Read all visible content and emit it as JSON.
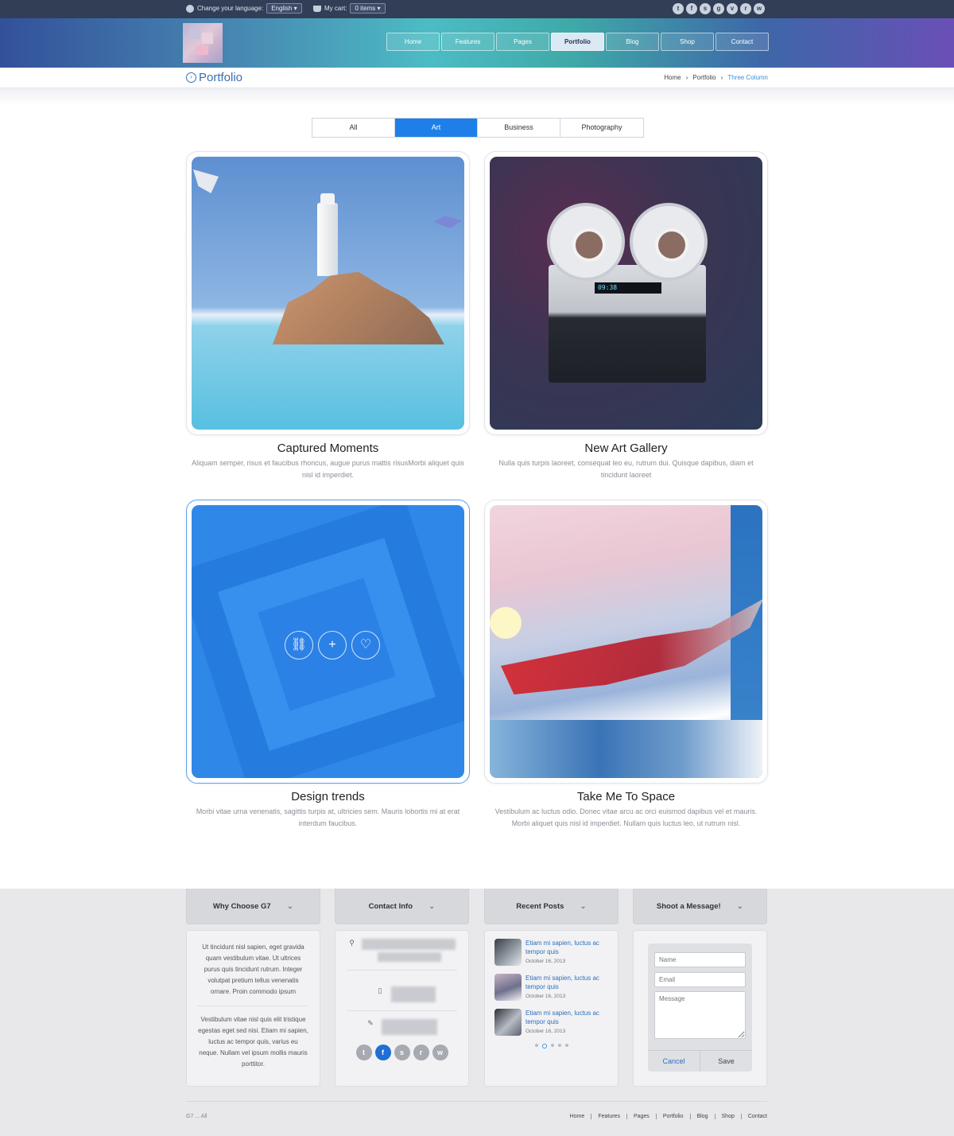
{
  "topbar": {
    "language_label": "Change your language:",
    "language_value": "English",
    "cart_label": "My cart:",
    "cart_value": "0 items",
    "social_icons": [
      "twitter-icon",
      "facebook-icon",
      "skype-icon",
      "google-plus-icon",
      "vimeo-icon",
      "rss-icon",
      "wordpress-icon"
    ]
  },
  "nav": {
    "items": [
      "Home",
      "Features",
      "Pages",
      "Portfolio",
      "Blog",
      "Shop",
      "Contact"
    ],
    "active": "Portfolio"
  },
  "page": {
    "title": "Portfolio",
    "breadcrumb": [
      "Home",
      "Portfolio",
      "Three Column"
    ]
  },
  "filters": {
    "items": [
      "All",
      "Art",
      "Business",
      "Photography"
    ],
    "active": "Art"
  },
  "portfolio": [
    {
      "title": "Captured Moments",
      "description": "Aliquam semper, risus et faucibus rhoncus, augue purus mattis risusMorbi aliquet quis nisl id imperdiet."
    },
    {
      "title": "New Art Gallery",
      "description": "Nulla quis turpis laoreet, consequat leo eu, rutrum dui. Quisque dapibus, diam et tincidunt laoreet",
      "display_text": "09:38"
    },
    {
      "title": "Design trends",
      "description": "Morbi vitae urna venenatis, sagittis turpis at, ultricies sem. Mauris lobortis mi at erat interdum faucibus.",
      "hover_icons": [
        "link-icon",
        "plus-icon",
        "heart-icon"
      ]
    },
    {
      "title": "Take Me To Space",
      "description": "Vestibulum ac luctus odio. Donec vitae arcu ac orci euismod dapibus vel et mauris. Morbi aliquet quis nisl id imperdiet. Nullam quis luctus leo, ut rutrum nisl."
    }
  ],
  "footer": {
    "why": {
      "heading": "Why Choose G7",
      "text1": "Ut tincidunt nisl sapien, eget gravida quam vestibulum vitae. Ut ultrices purus quis tincidunt rutrum. Integer volutpat pretium tellus venenatis ornare. Proin commodo ipsum",
      "text2": "Vestibulum vitae nisl quis elit tristique egestas eget sed nisi. Etiam mi sapien, luctus ac tempor quis, varius eu neque. Nullam vel ipsum mollis mauris porttitor."
    },
    "contact": {
      "heading": "Contact Info",
      "social_icons": [
        "twitter-icon",
        "facebook-icon",
        "skype-icon",
        "rss-icon",
        "wordpress-icon"
      ]
    },
    "recent": {
      "heading": "Recent Posts",
      "posts": [
        {
          "title": "Etiam mi sapien, luctus ac tempor quis",
          "date": "October 16, 2013"
        },
        {
          "title": "Etiam mi sapien, luctus ac tempor quis",
          "date": "October 16, 2013"
        },
        {
          "title": "Etiam mi sapien, luctus ac tempor quis",
          "date": "October 16, 2013"
        }
      ]
    },
    "message": {
      "heading": "Shoot a Message!",
      "name_placeholder": "Name",
      "email_placeholder": "Email",
      "message_placeholder": "Message",
      "cancel": "Cancel",
      "save": "Save"
    },
    "nav": [
      "Home",
      "Features",
      "Pages",
      "Portfolio",
      "Blog",
      "Shop",
      "Contact"
    ],
    "copyright": "G7 ... All"
  },
  "colors": {
    "accent": "#1f7fe8",
    "title": "#3b6fb1",
    "topbar": "#313e56",
    "link": "#2c6fbe"
  }
}
